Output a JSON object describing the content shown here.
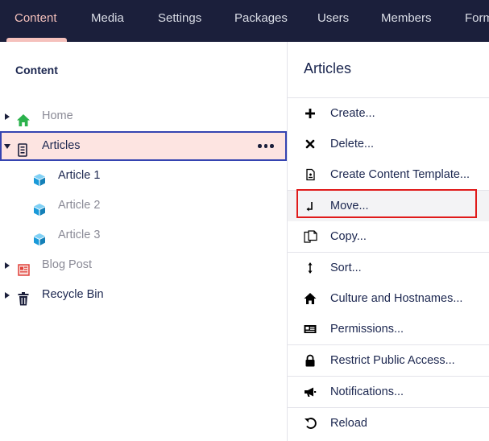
{
  "nav": {
    "tabs": [
      {
        "label": "Content",
        "active": true
      },
      {
        "label": "Media"
      },
      {
        "label": "Settings"
      },
      {
        "label": "Packages"
      },
      {
        "label": "Users"
      },
      {
        "label": "Members"
      },
      {
        "label": "Forms"
      }
    ],
    "colors": {
      "background": "#1b1f3b",
      "active": "#f5c1bc",
      "text": "#dadde6"
    }
  },
  "tree": {
    "title": "Content",
    "nodes": [
      {
        "label": "Home",
        "icon": "home-icon",
        "expandable": true
      },
      {
        "label": "Articles",
        "icon": "document-list-icon",
        "expanded": true,
        "selected": true
      },
      {
        "label": "Article 1",
        "icon": "cube-icon"
      },
      {
        "label": "Article 2",
        "icon": "cube-icon"
      },
      {
        "label": "Article 3",
        "icon": "cube-icon"
      },
      {
        "label": "Blog Post",
        "icon": "newspaper-icon",
        "expandable": true
      },
      {
        "label": "Recycle Bin",
        "icon": "trash-icon",
        "expandable": true
      }
    ],
    "more_label": "•••"
  },
  "actions": {
    "title": "Articles",
    "items": [
      {
        "label": "Create...",
        "icon": "plus-icon"
      },
      {
        "label": "Delete...",
        "icon": "close-icon"
      },
      {
        "label": "Create Content Template...",
        "icon": "document-template-icon"
      },
      {
        "label": "Move...",
        "icon": "move-icon",
        "highlighted": true
      },
      {
        "label": "Copy...",
        "icon": "copy-icon"
      },
      {
        "label": "Sort...",
        "icon": "sort-icon"
      },
      {
        "label": "Culture and Hostnames...",
        "icon": "home-icon"
      },
      {
        "label": "Permissions...",
        "icon": "permissions-icon"
      },
      {
        "label": "Restrict Public Access...",
        "icon": "lock-icon"
      },
      {
        "label": "Notifications...",
        "icon": "megaphone-icon"
      },
      {
        "label": "Reload",
        "icon": "reload-icon"
      }
    ]
  }
}
